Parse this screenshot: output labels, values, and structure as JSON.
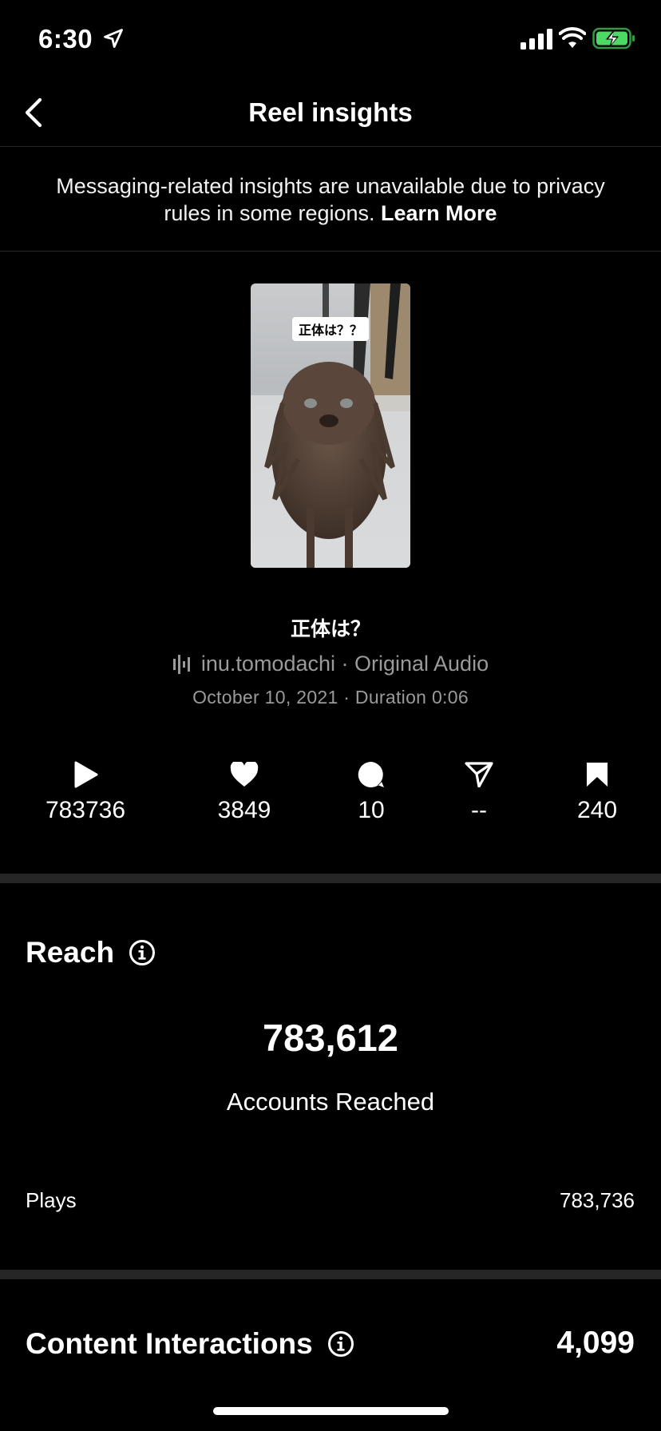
{
  "status_bar": {
    "time": "6:30",
    "icons": [
      "location-arrow-icon",
      "cellular-signal-icon",
      "wifi-icon",
      "battery-charging-icon"
    ]
  },
  "nav": {
    "title": "Reel insights",
    "back_icon": "chevron-left-icon"
  },
  "notice": {
    "text": "Messaging-related insights are unavailable due to privacy rules in some regions. ",
    "link": "Learn More"
  },
  "reel": {
    "thumbnail_caption": "正体は？？",
    "title": "正体は？",
    "audio": "inu.tomodachi · Original Audio",
    "meta": "October 10, 2021 · Duration 0:06"
  },
  "metrics": [
    {
      "icon": "play-icon",
      "value": "783736"
    },
    {
      "icon": "heart-icon",
      "value": "3849"
    },
    {
      "icon": "comment-icon",
      "value": "10"
    },
    {
      "icon": "share-icon",
      "value": "--"
    },
    {
      "icon": "bookmark-icon",
      "value": "240"
    }
  ],
  "reach": {
    "title": "Reach",
    "value": "783,612",
    "label": "Accounts Reached",
    "plays_label": "Plays",
    "plays_value": "783,736"
  },
  "content_interactions": {
    "title": "Content Interactions",
    "value": "4,099"
  },
  "colors": {
    "background": "#000000",
    "divider": "#262626",
    "secondary_text": "#9a9a9a",
    "battery_green": "#4cd964"
  }
}
